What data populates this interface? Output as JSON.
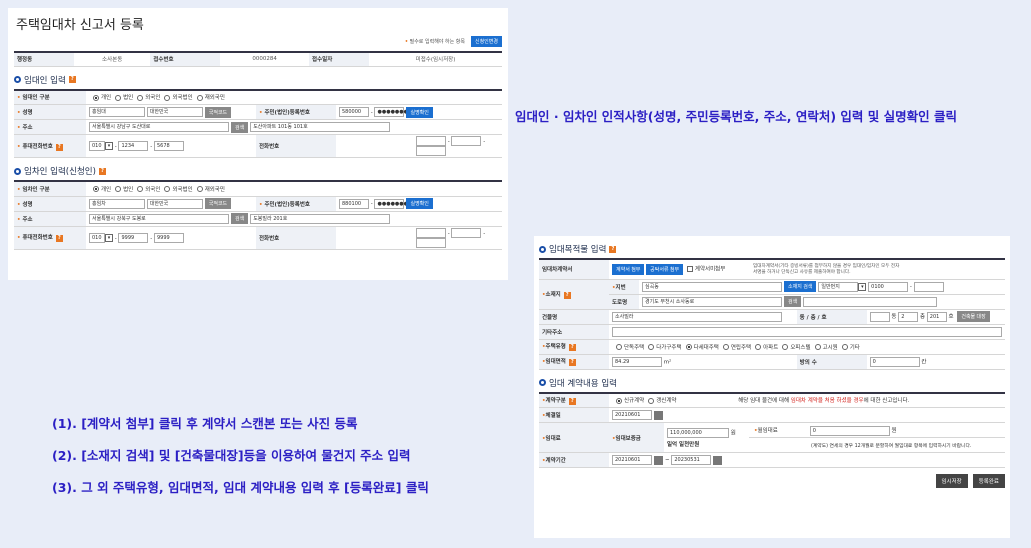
{
  "p1": {
    "title": "주택임대차 신고서 등록",
    "required_note": "필수로 입력해야 하는 항목",
    "change_btn": "신청인변경",
    "top": {
      "c1h": "행정동",
      "c1v": "소사본동",
      "c2h": "접수번호",
      "c2v": "0000284",
      "c3h": "접수일자",
      "c3v": "미접수(임시저장)"
    },
    "lessor": {
      "section": "임대인 입력",
      "type_label": "임대인 구분",
      "types": [
        "개인",
        "법인",
        "외국인",
        "외국법인",
        "재외국민"
      ],
      "name_label": "성명",
      "name": "홍임대",
      "nation": "대한민국",
      "nation_btn": "국적코드",
      "rrn_label": "주민(법인)등록번호",
      "rrn1": "580000",
      "rrn2": "●●●●●●●",
      "verify_btn": "실명확인",
      "addr_label": "주소",
      "addr": "서울특별시 강남구 도산대로",
      "search_btn": "검색",
      "addr2": "도산아파트 101동 101호",
      "phone_label": "휴대전화번호",
      "p1": "010",
      "p2": "1234",
      "p3": "5678",
      "tel_label": "전화번호"
    },
    "lessee": {
      "section": "임차인 입력(신청인)",
      "type_label": "임차인 구분",
      "types": [
        "개인",
        "법인",
        "외국인",
        "외국법인",
        "재외국민"
      ],
      "name_label": "성명",
      "name": "홍임차",
      "nation": "대한민국",
      "nation_btn": "국적코드",
      "rrn_label": "주민(법인)등록번호",
      "rrn1": "880100",
      "rrn2": "●●●●●●●",
      "verify_btn": "실명확인",
      "addr_label": "주소",
      "addr": "서울특별시 강북구 도봉로",
      "search_btn": "검색",
      "addr2": "도봉빌라 201호",
      "phone_label": "휴대전화번호",
      "p1": "010",
      "p2": "9999",
      "p3": "9999",
      "tel_label": "전화번호"
    }
  },
  "annot": {
    "right": "임대인 · 임차인 인적사항(성명, 주민등록번호, 주소, 연락처) 입력 및 실명확인 클릭",
    "s1": "(1). [계약서 첨부] 클릭 후 계약서 스캔본 또는 사진 등록",
    "s2": "(2). [소재지 검색] 및 [건축물대장]등을 이용하여 물건지 주소 입력",
    "s3": "(3). 그 외 주택유형, 임대면적, 임대 계약내용 입력 후 [등록완료] 클릭"
  },
  "p2": {
    "sec1": "임대목적물 입력",
    "contract_label": "임대차계약서",
    "attach_btn": "계약서 첨부",
    "share_btn": "공탁서류 첨부",
    "unreg": "계약서미첨부",
    "attach_note": "임대차계약서(기타 증빙서류)를 첨부하지 않을 경우 임대인/임차인 모두 전자서명을 하거나 단독신고 사유를 제출하여야 합니다.",
    "loc_label": "소재지",
    "jibun_label": "지번",
    "jibun": "심곡동",
    "loc_search": "소재지 검색",
    "jibun_type": "일반번지",
    "jibun_no": "0100",
    "road_label": "도로명",
    "road": "경기도 부천시 소사동로",
    "road_search": "검색",
    "bld_label": "건물명",
    "bld": "소사빌라",
    "dong_label": "동 / 층 / 호",
    "floor": "2",
    "ho": "201",
    "dong_unit": "동",
    "floor_unit": "층",
    "ho_unit": "호",
    "bld_reg": "건축물 대장",
    "etc_label": "기타주소",
    "htype_label": "주택유형",
    "htypes": [
      "단독주택",
      "다가구주택",
      "다세대주택",
      "연립주택",
      "아파트",
      "오피스텔",
      "고시원",
      "기타"
    ],
    "area_label": "임대면적",
    "area": "84.29",
    "area_unit": "m²",
    "rooms_label": "방의 수",
    "rooms": "0",
    "rooms_unit": "칸",
    "sec2": "임대 계약내용 입력",
    "ctype_label": "계약구분",
    "ctypes": [
      "신규계약",
      "갱신계약"
    ],
    "cnote_a": "해당 임대 물건에 대해 ",
    "cnote_red": "임대차 계약을 처음 하셨을 경우",
    "cnote_b": "에 대한 신고입니다.",
    "cdate_label": "체결일",
    "cdate": "20210601",
    "fee_label": "임대료",
    "deposit_label": "임대보증금",
    "deposit": "110,000,000",
    "won": "원",
    "deposit_kor": "일억 일천만원",
    "monthly_label": "월임대료",
    "monthly": "0",
    "monthly_note": "(계약도) 연세의 경우 12개월로 분할하여 월임대료 항목에 입력하시기 바랍니다.",
    "period_label": "계약기간",
    "start": "20210601",
    "tilde": "~",
    "end": "20230531",
    "save_btn": "임시저장",
    "done_btn": "등록완료"
  }
}
